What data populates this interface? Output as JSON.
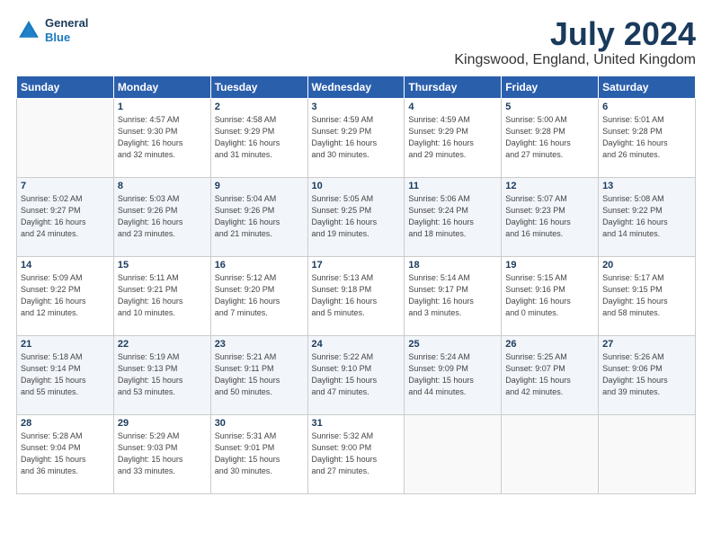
{
  "logo": {
    "general": "General",
    "blue": "Blue"
  },
  "title": "July 2024",
  "subtitle": "Kingswood, England, United Kingdom",
  "weekdays": [
    "Sunday",
    "Monday",
    "Tuesday",
    "Wednesday",
    "Thursday",
    "Friday",
    "Saturday"
  ],
  "weeks": [
    [
      {
        "num": "",
        "info": ""
      },
      {
        "num": "1",
        "info": "Sunrise: 4:57 AM\nSunset: 9:30 PM\nDaylight: 16 hours\nand 32 minutes."
      },
      {
        "num": "2",
        "info": "Sunrise: 4:58 AM\nSunset: 9:29 PM\nDaylight: 16 hours\nand 31 minutes."
      },
      {
        "num": "3",
        "info": "Sunrise: 4:59 AM\nSunset: 9:29 PM\nDaylight: 16 hours\nand 30 minutes."
      },
      {
        "num": "4",
        "info": "Sunrise: 4:59 AM\nSunset: 9:29 PM\nDaylight: 16 hours\nand 29 minutes."
      },
      {
        "num": "5",
        "info": "Sunrise: 5:00 AM\nSunset: 9:28 PM\nDaylight: 16 hours\nand 27 minutes."
      },
      {
        "num": "6",
        "info": "Sunrise: 5:01 AM\nSunset: 9:28 PM\nDaylight: 16 hours\nand 26 minutes."
      }
    ],
    [
      {
        "num": "7",
        "info": "Sunrise: 5:02 AM\nSunset: 9:27 PM\nDaylight: 16 hours\nand 24 minutes."
      },
      {
        "num": "8",
        "info": "Sunrise: 5:03 AM\nSunset: 9:26 PM\nDaylight: 16 hours\nand 23 minutes."
      },
      {
        "num": "9",
        "info": "Sunrise: 5:04 AM\nSunset: 9:26 PM\nDaylight: 16 hours\nand 21 minutes."
      },
      {
        "num": "10",
        "info": "Sunrise: 5:05 AM\nSunset: 9:25 PM\nDaylight: 16 hours\nand 19 minutes."
      },
      {
        "num": "11",
        "info": "Sunrise: 5:06 AM\nSunset: 9:24 PM\nDaylight: 16 hours\nand 18 minutes."
      },
      {
        "num": "12",
        "info": "Sunrise: 5:07 AM\nSunset: 9:23 PM\nDaylight: 16 hours\nand 16 minutes."
      },
      {
        "num": "13",
        "info": "Sunrise: 5:08 AM\nSunset: 9:22 PM\nDaylight: 16 hours\nand 14 minutes."
      }
    ],
    [
      {
        "num": "14",
        "info": "Sunrise: 5:09 AM\nSunset: 9:22 PM\nDaylight: 16 hours\nand 12 minutes."
      },
      {
        "num": "15",
        "info": "Sunrise: 5:11 AM\nSunset: 9:21 PM\nDaylight: 16 hours\nand 10 minutes."
      },
      {
        "num": "16",
        "info": "Sunrise: 5:12 AM\nSunset: 9:20 PM\nDaylight: 16 hours\nand 7 minutes."
      },
      {
        "num": "17",
        "info": "Sunrise: 5:13 AM\nSunset: 9:18 PM\nDaylight: 16 hours\nand 5 minutes."
      },
      {
        "num": "18",
        "info": "Sunrise: 5:14 AM\nSunset: 9:17 PM\nDaylight: 16 hours\nand 3 minutes."
      },
      {
        "num": "19",
        "info": "Sunrise: 5:15 AM\nSunset: 9:16 PM\nDaylight: 16 hours\nand 0 minutes."
      },
      {
        "num": "20",
        "info": "Sunrise: 5:17 AM\nSunset: 9:15 PM\nDaylight: 15 hours\nand 58 minutes."
      }
    ],
    [
      {
        "num": "21",
        "info": "Sunrise: 5:18 AM\nSunset: 9:14 PM\nDaylight: 15 hours\nand 55 minutes."
      },
      {
        "num": "22",
        "info": "Sunrise: 5:19 AM\nSunset: 9:13 PM\nDaylight: 15 hours\nand 53 minutes."
      },
      {
        "num": "23",
        "info": "Sunrise: 5:21 AM\nSunset: 9:11 PM\nDaylight: 15 hours\nand 50 minutes."
      },
      {
        "num": "24",
        "info": "Sunrise: 5:22 AM\nSunset: 9:10 PM\nDaylight: 15 hours\nand 47 minutes."
      },
      {
        "num": "25",
        "info": "Sunrise: 5:24 AM\nSunset: 9:09 PM\nDaylight: 15 hours\nand 44 minutes."
      },
      {
        "num": "26",
        "info": "Sunrise: 5:25 AM\nSunset: 9:07 PM\nDaylight: 15 hours\nand 42 minutes."
      },
      {
        "num": "27",
        "info": "Sunrise: 5:26 AM\nSunset: 9:06 PM\nDaylight: 15 hours\nand 39 minutes."
      }
    ],
    [
      {
        "num": "28",
        "info": "Sunrise: 5:28 AM\nSunset: 9:04 PM\nDaylight: 15 hours\nand 36 minutes."
      },
      {
        "num": "29",
        "info": "Sunrise: 5:29 AM\nSunset: 9:03 PM\nDaylight: 15 hours\nand 33 minutes."
      },
      {
        "num": "30",
        "info": "Sunrise: 5:31 AM\nSunset: 9:01 PM\nDaylight: 15 hours\nand 30 minutes."
      },
      {
        "num": "31",
        "info": "Sunrise: 5:32 AM\nSunset: 9:00 PM\nDaylight: 15 hours\nand 27 minutes."
      },
      {
        "num": "",
        "info": ""
      },
      {
        "num": "",
        "info": ""
      },
      {
        "num": "",
        "info": ""
      }
    ]
  ]
}
